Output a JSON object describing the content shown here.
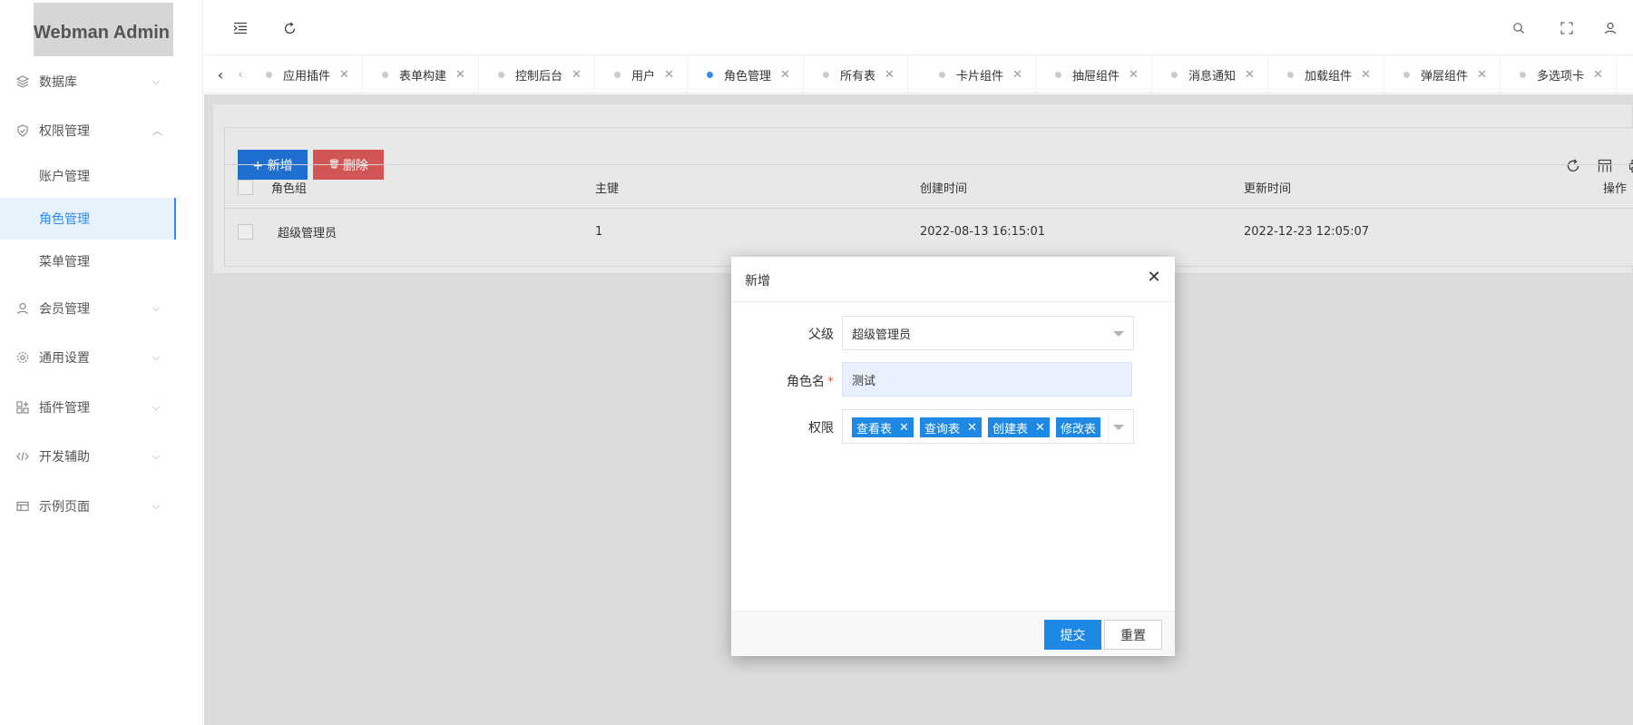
{
  "app": {
    "title": "Webman Admin"
  },
  "sidebar": {
    "items": [
      {
        "label": "数据库",
        "icon": "layers-icon",
        "arrow": "chevron-down"
      },
      {
        "label": "权限管理",
        "icon": "shield-icon",
        "arrow": "chevron-up"
      },
      {
        "label": "会员管理",
        "icon": "user-icon",
        "arrow": "chevron-down"
      },
      {
        "label": "通用设置",
        "icon": "gear-icon",
        "arrow": "chevron-down"
      },
      {
        "label": "插件管理",
        "icon": "apps-icon",
        "arrow": "chevron-down"
      },
      {
        "label": "开发辅助",
        "icon": "code-icon",
        "arrow": "chevron-down"
      },
      {
        "label": "示例页面",
        "icon": "template-icon",
        "arrow": "chevron-down"
      }
    ],
    "subitems": [
      {
        "label": "账户管理"
      },
      {
        "label": "角色管理",
        "active": true
      },
      {
        "label": "菜单管理"
      }
    ]
  },
  "tabs": [
    {
      "label": "应用插件"
    },
    {
      "label": "表单构建"
    },
    {
      "label": "控制后台"
    },
    {
      "label": "用户"
    },
    {
      "label": "角色管理",
      "active": true
    },
    {
      "label": "所有表"
    },
    {
      "label": "卡片组件"
    },
    {
      "label": "抽屉组件"
    },
    {
      "label": "消息通知"
    },
    {
      "label": "加载组件"
    },
    {
      "label": "弹层组件"
    },
    {
      "label": "多选项卡"
    }
  ],
  "toolbar": {
    "add_label": "+ 新增",
    "delete_label": "删除"
  },
  "table": {
    "headers": [
      "角色组",
      "主键",
      "创建时间",
      "更新时间",
      "操作"
    ],
    "rows": [
      [
        "超级管理员",
        "1",
        "2022-08-13 16:15:01",
        "2022-12-23 12:05:07"
      ]
    ]
  },
  "dialog": {
    "title": "新增",
    "fields": {
      "parent": {
        "label": "父级",
        "value": "超级管理员"
      },
      "name": {
        "label": "角色名",
        "value": "测试"
      },
      "perms": {
        "label": "权限",
        "tags": [
          "查看表",
          "查询表",
          "创建表",
          "修改表"
        ]
      }
    },
    "submit_label": "提交",
    "reset_label": "重置"
  },
  "colors": {
    "primary": "#1e6fd0",
    "danger": "#d25555",
    "tag": "#1e88e5"
  }
}
